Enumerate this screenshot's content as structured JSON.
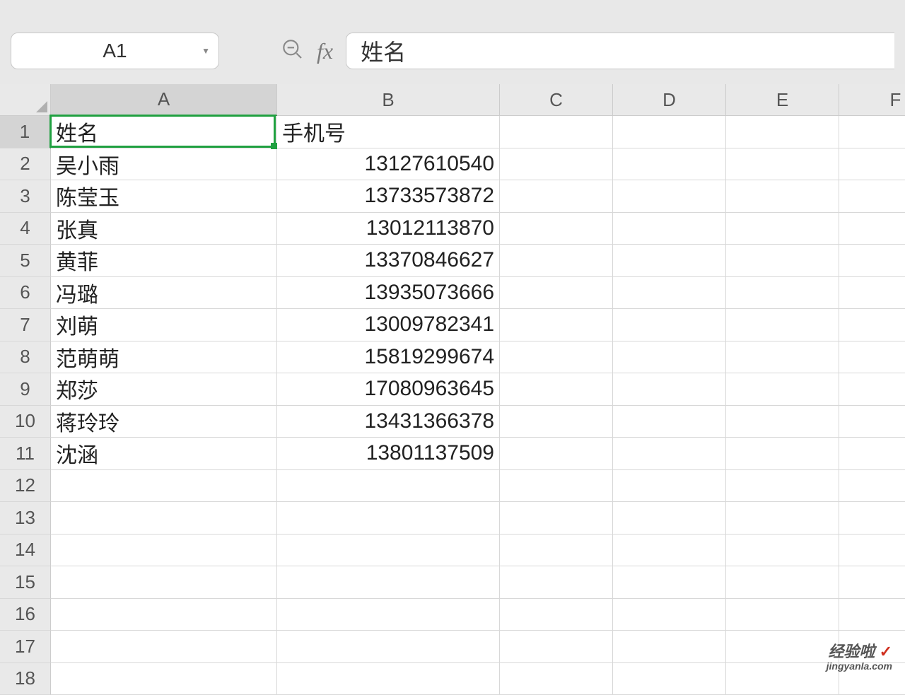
{
  "nameBox": "A1",
  "formulaValue": "姓名",
  "columns": [
    "A",
    "B",
    "C",
    "D",
    "E",
    "F"
  ],
  "rowCount": 18,
  "activeCol": "A",
  "activeRow": 1,
  "header": {
    "A": "姓名",
    "B": "手机号"
  },
  "rows": [
    {
      "A": "吴小雨",
      "B": "13127610540"
    },
    {
      "A": "陈莹玉",
      "B": "13733573872"
    },
    {
      "A": "张真",
      "B": "13012113870"
    },
    {
      "A": "黄菲",
      "B": "13370846627"
    },
    {
      "A": "冯璐",
      "B": "13935073666"
    },
    {
      "A": "刘萌",
      "B": "13009782341"
    },
    {
      "A": "范萌萌",
      "B": "15819299674"
    },
    {
      "A": "郑莎",
      "B": "17080963645"
    },
    {
      "A": "蒋玲玲",
      "B": "13431366378"
    },
    {
      "A": "沈涵",
      "B": "13801137509"
    }
  ],
  "watermark": {
    "line1_text": "经验啦",
    "line1_check": "✓",
    "line2": "jingyanla.com"
  }
}
